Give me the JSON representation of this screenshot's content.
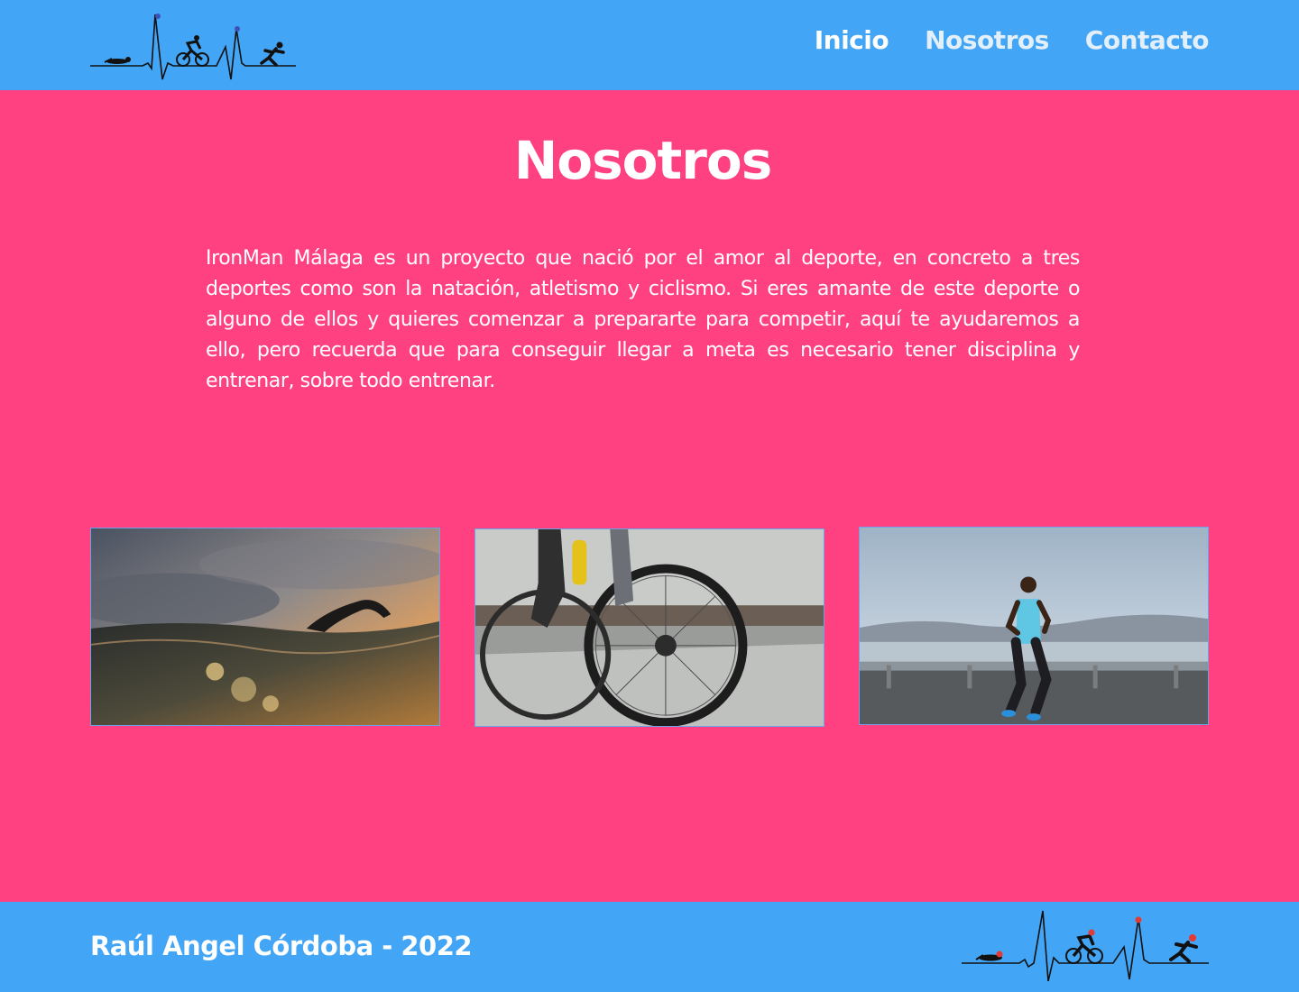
{
  "header": {
    "logo_icon": "triathlon-heartbeat-logo",
    "nav": [
      {
        "label": "Inicio"
      },
      {
        "label": "Nosotros"
      },
      {
        "label": "Contacto"
      }
    ]
  },
  "main": {
    "title": "Nosotros",
    "intro": "IronMan Málaga es un proyecto que nació por el amor al deporte, en concreto a tres deportes como son la natación, atletismo y ciclismo. Si eres amante de este deporte o alguno de ellos y quieres comenzar a prepararte para competir, aquí te ayudaremos a ello, pero recuerda que para conseguir llegar a meta es necesario tener disciplina y entrenar, sobre todo entrenar.",
    "photos": [
      {
        "subject": "swimmer-photo"
      },
      {
        "subject": "cyclist-photo"
      },
      {
        "subject": "runner-photo"
      }
    ]
  },
  "footer": {
    "credit": "Raúl Angel Córdoba - 2022",
    "logo_icon": "triathlon-heartbeat-logo"
  },
  "colors": {
    "header_bg": "#42a5f5",
    "main_bg": "#ff4081",
    "text": "#ffffff"
  }
}
